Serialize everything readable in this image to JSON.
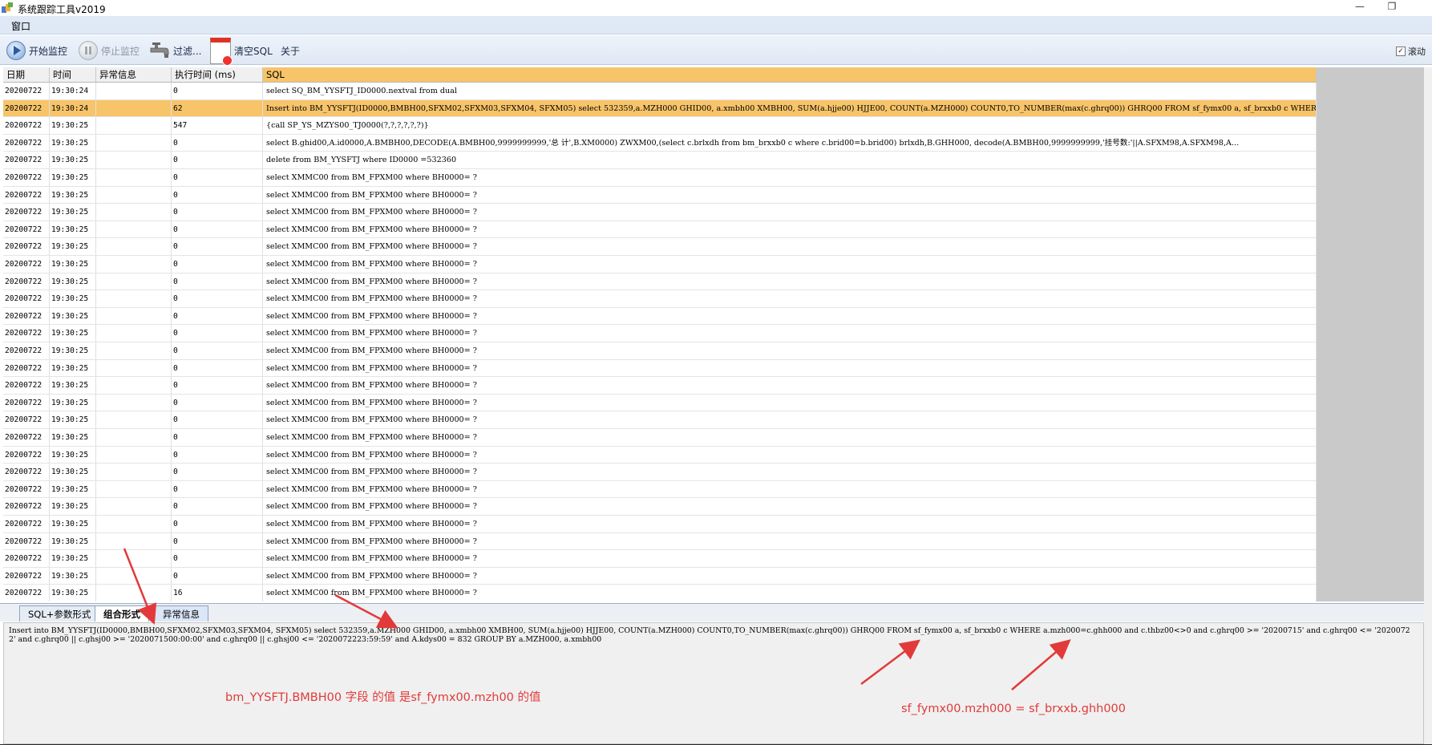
{
  "window": {
    "title": "系统跟踪工具v2019",
    "minimize": "—",
    "restore": "❐"
  },
  "menu": {
    "items": [
      "窗口"
    ]
  },
  "toolbar": {
    "start": "开始监控",
    "stop": "停止监控",
    "filter": "过滤...",
    "clear": "清空SQL",
    "about": "关于",
    "scroll_label": "滚动"
  },
  "grid": {
    "columns": [
      "日期",
      "时间",
      "异常信息",
      "执行时间 (ms)",
      "SQL"
    ],
    "selected_index": 1,
    "rows": [
      [
        "20200722",
        "19:30:24",
        "",
        "0",
        " select SQ_BM_YYSFTJ_ID0000.nextval from dual"
      ],
      [
        "20200722",
        "19:30:24",
        "",
        "62",
        " Insert into  BM_YYSFTJ(ID0000,BMBH00,SFXM02,SFXM03,SFXM04, SFXM05)  select 532359,a.MZH000 GHID00, a.xmbh00 XMBH00, SUM(a.hjje00) HJJE00,  COUNT(a.MZH000) COUNT0,TO_NUMBER(max(c.ghrq00)) GHRQ00 FROM sf_fymx00 a, sf_brxxb0 c WHER..."
      ],
      [
        "20200722",
        "19:30:25",
        "",
        "547",
        "{call SP_YS_MZYS00_TJ0000(?,?,?,?,?,?)}"
      ],
      [
        "20200722",
        "19:30:25",
        "",
        "0",
        " select  B.ghid00,A.id0000,A.BMBH00,DECODE(A.BMBH00,9999999999,'总 计',B.XM0000) ZWXM00,(select c.brlxdh from bm_brxxb0 c where c.brid00=b.brid00) brlxdh,B.GHH000,  decode(A.BMBH00,9999999999,'挂号数:'||A.SFXM98,A.SFXM98,A..."
      ],
      [
        "20200722",
        "19:30:25",
        "",
        "0",
        "delete from BM_YYSFTJ where ID0000 =532360"
      ],
      [
        "20200722",
        "19:30:25",
        "",
        "0",
        "select XMMC00 from BM_FPXM00  where  BH0000= ?"
      ],
      [
        "20200722",
        "19:30:25",
        "",
        "0",
        "select XMMC00 from BM_FPXM00  where  BH0000= ?"
      ],
      [
        "20200722",
        "19:30:25",
        "",
        "0",
        "select XMMC00 from BM_FPXM00  where  BH0000= ?"
      ],
      [
        "20200722",
        "19:30:25",
        "",
        "0",
        "select XMMC00 from BM_FPXM00  where  BH0000= ?"
      ],
      [
        "20200722",
        "19:30:25",
        "",
        "0",
        "select XMMC00 from BM_FPXM00  where  BH0000= ?"
      ],
      [
        "20200722",
        "19:30:25",
        "",
        "0",
        "select XMMC00 from BM_FPXM00  where  BH0000= ?"
      ],
      [
        "20200722",
        "19:30:25",
        "",
        "0",
        "select XMMC00 from BM_FPXM00  where  BH0000= ?"
      ],
      [
        "20200722",
        "19:30:25",
        "",
        "0",
        "select XMMC00 from BM_FPXM00  where  BH0000= ?"
      ],
      [
        "20200722",
        "19:30:25",
        "",
        "0",
        "select XMMC00 from BM_FPXM00  where  BH0000= ?"
      ],
      [
        "20200722",
        "19:30:25",
        "",
        "0",
        "select XMMC00 from BM_FPXM00  where  BH0000= ?"
      ],
      [
        "20200722",
        "19:30:25",
        "",
        "0",
        "select XMMC00 from BM_FPXM00  where  BH0000= ?"
      ],
      [
        "20200722",
        "19:30:25",
        "",
        "0",
        "select XMMC00 from BM_FPXM00  where  BH0000= ?"
      ],
      [
        "20200722",
        "19:30:25",
        "",
        "0",
        "select XMMC00 from BM_FPXM00  where  BH0000= ?"
      ],
      [
        "20200722",
        "19:30:25",
        "",
        "0",
        "select XMMC00 from BM_FPXM00  where  BH0000= ?"
      ],
      [
        "20200722",
        "19:30:25",
        "",
        "0",
        "select XMMC00 from BM_FPXM00  where  BH0000= ?"
      ],
      [
        "20200722",
        "19:30:25",
        "",
        "0",
        "select XMMC00 from BM_FPXM00  where  BH0000= ?"
      ],
      [
        "20200722",
        "19:30:25",
        "",
        "0",
        "select XMMC00 from BM_FPXM00  where  BH0000= ?"
      ],
      [
        "20200722",
        "19:30:25",
        "",
        "0",
        "select XMMC00 from BM_FPXM00  where  BH0000= ?"
      ],
      [
        "20200722",
        "19:30:25",
        "",
        "0",
        "select XMMC00 from BM_FPXM00  where  BH0000= ?"
      ],
      [
        "20200722",
        "19:30:25",
        "",
        "0",
        "select XMMC00 from BM_FPXM00  where  BH0000= ?"
      ],
      [
        "20200722",
        "19:30:25",
        "",
        "0",
        "select XMMC00 from BM_FPXM00  where  BH0000= ?"
      ],
      [
        "20200722",
        "19:30:25",
        "",
        "0",
        "select XMMC00 from BM_FPXM00  where  BH0000= ?"
      ],
      [
        "20200722",
        "19:30:25",
        "",
        "0",
        "select XMMC00 from BM_FPXM00  where  BH0000= ?"
      ],
      [
        "20200722",
        "19:30:25",
        "",
        "0",
        "select XMMC00 from BM_FPXM00  where  BH0000= ?"
      ],
      [
        "20200722",
        "19:30:25",
        "",
        "16",
        "select XMMC00 from BM_FPXM00  where  BH0000= ?"
      ]
    ]
  },
  "tabs": [
    "SQL+参数形式",
    "组合形式",
    "异常信息"
  ],
  "active_tab": 1,
  "detail_sql": "Insert into  BM_YYSFTJ(ID0000,BMBH00,SFXM02,SFXM03,SFXM04, SFXM05)  select 532359,a.MZH000 GHID00, a.xmbh00 XMBH00, SUM(a.hjje00) HJJE00,  COUNT(a.MZH000) COUNT0,TO_NUMBER(max(c.ghrq00)) GHRQ00 FROM sf_fymx00 a,  sf_brxxb0 c WHERE  a.mzh000=c.ghh000 and c.thbz00<>0  and c.ghrq00 >= '20200715'  and c.ghrq00 <= '20200722'  and c.ghrq00 || c.ghsj00 >= '2020071500:00:00'  and c.ghrq00 || c.ghsj00 <= '2020072223:59:59'  and A.kdys00 = 832  GROUP BY a.MZH000, a.xmbh00",
  "annotations": {
    "note1": "bm_YYSFTJ.BMBH00 字段 的值 是sf_fymx00.mzh00 的值",
    "note2": "sf_fymx00.mzh000 = sf_brxxb.ghh000"
  },
  "colors": {
    "selected_row": "#f7c46a",
    "annotation": "#e23a3a"
  }
}
